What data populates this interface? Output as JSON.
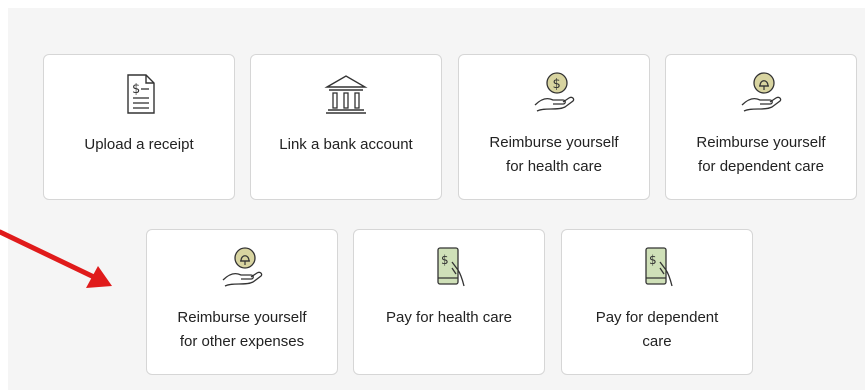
{
  "colors": {
    "background": "#f5f5f5",
    "tile": "#ffffff",
    "tile_border": "#d6d6d6",
    "icon_stroke": "#333333",
    "coin_fill": "#d8d4a0",
    "phone_fill": "#cfe0b8",
    "annotation_arrow": "#e01b1b"
  },
  "tiles": [
    {
      "icon": "receipt-icon",
      "label_line1": "Upload a receipt",
      "label_line2": ""
    },
    {
      "icon": "bank-icon",
      "label_line1": "Link a bank account",
      "label_line2": ""
    },
    {
      "icon": "hand-dollar-coin-icon",
      "label_line1": "Reimburse yourself",
      "label_line2": "for health care"
    },
    {
      "icon": "hand-bell-coin-icon",
      "label_line1": "Reimburse yourself",
      "label_line2": "for dependent care"
    },
    {
      "icon": "hand-bell-coin-icon",
      "label_line1": "Reimburse yourself",
      "label_line2": "for other expenses"
    },
    {
      "icon": "phone-pay-icon",
      "label_line1": "Pay for health care",
      "label_line2": ""
    },
    {
      "icon": "phone-pay-icon",
      "label_line1": "Pay for dependent",
      "label_line2": "care"
    }
  ],
  "annotation": {
    "icon": "red-arrow-icon"
  }
}
